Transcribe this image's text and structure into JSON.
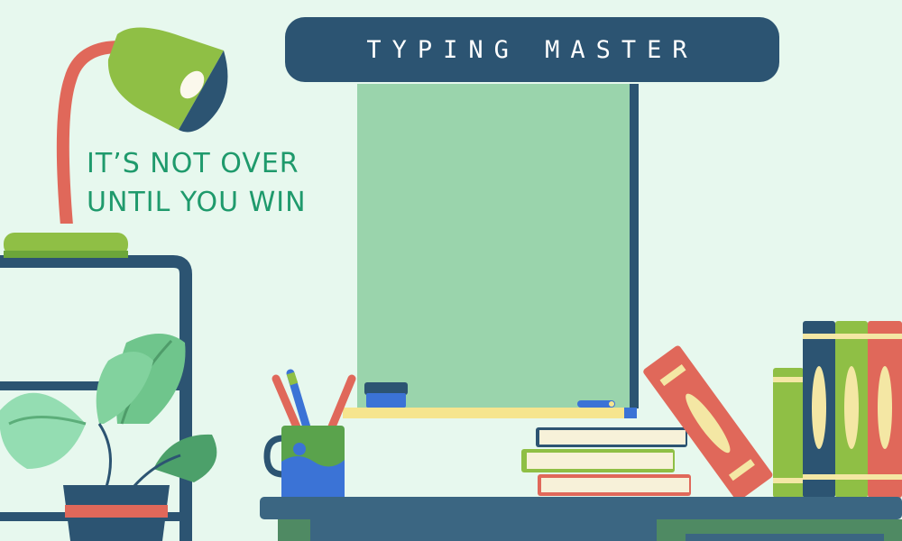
{
  "game": {
    "title": "TYPING MASTER",
    "motto_line1": "IT’S NOT OVER",
    "motto_line2": "UNTIL YOU WIN"
  },
  "colors": {
    "background": "#e7f8ee",
    "banner": "#2c5472",
    "motto_text": "#1f9a6c",
    "chalkboard": "#9ad4ac",
    "frame": "#2c5472",
    "lamp_green": "#8fbf45",
    "lamp_arm": "#e0685a",
    "book_red": "#e0685a",
    "book_green": "#8fbf45",
    "book_navy": "#2c5472",
    "book_cream": "#f4e7a4",
    "desk_top": "#3b6682",
    "desk_body": "#4f8a63",
    "mug": "#5aa34c",
    "mug_blue": "#3b73d6"
  },
  "icons": {
    "desk_lamp": "desk-lamp-icon",
    "plant": "potted-plant-icon",
    "pencil_cup": "pencil-cup-icon",
    "eraser": "chalkboard-eraser-icon",
    "chalk": "chalk-icon"
  }
}
